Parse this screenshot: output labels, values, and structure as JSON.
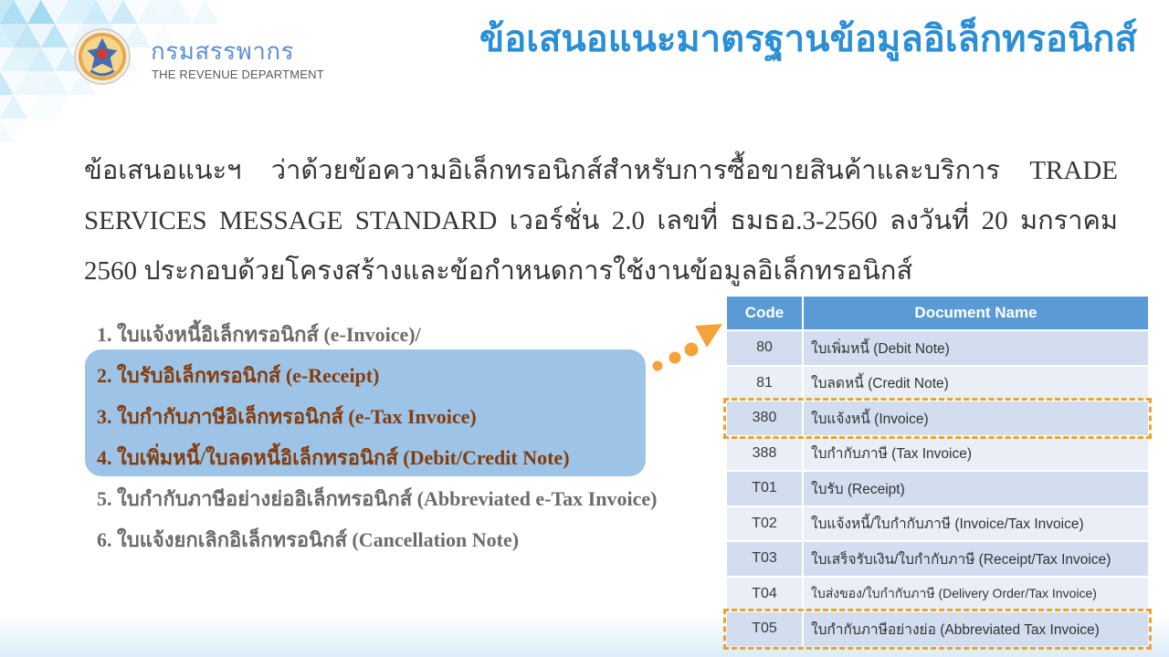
{
  "header": {
    "org_name_th": "กรมสรรพากร",
    "org_name_en": "THE REVENUE DEPARTMENT",
    "title": "ข้อเสนอแนะมาตรฐานข้อมูลอิเล็กทรอนิกส์"
  },
  "icons": {
    "logo": "revenue-department-seal",
    "pointer": "dotted-arrow",
    "background": "triangle-pattern"
  },
  "intro": {
    "text": "ข้อเสนอแนะฯ ว่าด้วยข้อความอิเล็กทรอนิกส์สำหรับการซื้อขายสินค้าและบริการ TRADE SERVICES MESSAGE STANDARD เวอร์ชั่น 2.0 เลขที่ ธมธอ.3-2560 ลงวันที่ 20 มกราคม 2560 ประกอบด้วยโครงสร้างและข้อกำหนดการใช้งานข้อมูลอิเล็กทรอนิกส์"
  },
  "document_list": {
    "items": [
      {
        "text": "1. ใบแจ้งหนี้อิเล็กทรอนิกส์ (e-Invoice)/",
        "in_highlight_box": false
      },
      {
        "text": "2. ใบรับอิเล็กทรอนิกส์ (e-Receipt)",
        "in_highlight_box": true
      },
      {
        "text": "3. ใบกำกับภาษีอิเล็กทรอนิกส์ (e-Tax Invoice)",
        "in_highlight_box": true
      },
      {
        "text": "4. ใบเพิ่มหนี้/ใบลดหนี้อิเล็กทรอนิกส์ (Debit/Credit Note)",
        "in_highlight_box": true
      },
      {
        "text": "5. ใบกำกับภาษีอย่างย่ออิเล็กทรอนิกส์ (Abbreviated e-Tax Invoice)",
        "in_highlight_box": false
      },
      {
        "text": "6. ใบแจ้งยกเลิกอิเล็กทรอนิกส์ (Cancellation Note)",
        "in_highlight_box": false
      }
    ]
  },
  "code_table": {
    "headers": {
      "code": "Code",
      "name": "Document Name"
    },
    "rows": [
      {
        "code": "80",
        "name": "ใบเพิ่มหนี้ (Debit Note)",
        "dashed_outline": false
      },
      {
        "code": "81",
        "name": "ใบลดหนี้ (Credit Note)",
        "dashed_outline": false
      },
      {
        "code": "380",
        "name": "ใบแจ้งหนี้ (Invoice)",
        "dashed_outline": true
      },
      {
        "code": "388",
        "name": "ใบกำกับภาษี (Tax Invoice)",
        "dashed_outline": false
      },
      {
        "code": "T01",
        "name": "ใบรับ (Receipt)",
        "dashed_outline": false
      },
      {
        "code": "T02",
        "name": "ใบแจ้งหนี้/ใบกำกับภาษี (Invoice/Tax Invoice)",
        "dashed_outline": false
      },
      {
        "code": "T03",
        "name": "ใบเสร็จรับเงิน/ใบกำกับภาษี (Receipt/Tax Invoice)",
        "dashed_outline": false
      },
      {
        "code": "T04",
        "name": "ใบส่งของ/ใบกำกับภาษี (Delivery Order/Tax Invoice)",
        "dashed_outline": false
      },
      {
        "code": "T05",
        "name": "ใบกำกับภาษีอย่างย่อ (Abbreviated Tax Invoice)",
        "dashed_outline": true
      }
    ]
  },
  "colors": {
    "title": "#2b8fd6",
    "org_name": "#5b8fd2",
    "intro_text": "#363636",
    "list_text": "#6b6b6b",
    "highlight_box": "#9dc3e6",
    "highlight_text": "#843c0c",
    "table_header": "#5b9bd5",
    "table_band_dark": "#d2deef",
    "table_band_light": "#eaeff7",
    "dashed_outline": "#f0a030",
    "pointer_arrow": "#f3a33a"
  }
}
